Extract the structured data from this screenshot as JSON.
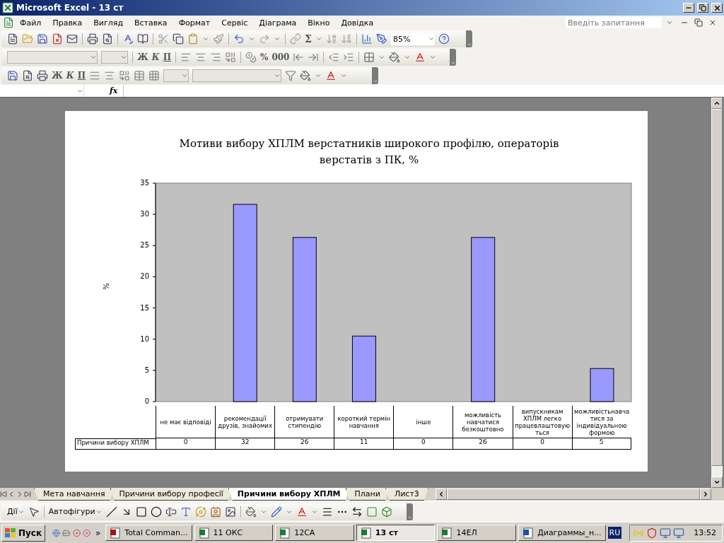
{
  "window": {
    "title": "Microsoft Excel - 13 ст"
  },
  "menu": {
    "items": [
      "Файл",
      "Правка",
      "Вигляд",
      "Вставка",
      "Формат",
      "Сервіс",
      "Діаграма",
      "Вікно",
      "Довідка"
    ],
    "help_field": {
      "placeholder": "Введіть запитання"
    }
  },
  "standard_toolbar": {
    "sum": "Σ",
    "zoom": "85%"
  },
  "format_toolbar": {
    "bold": "Ж",
    "italic": "К",
    "underline": "П",
    "percent": "%",
    "thousands": "000"
  },
  "chart_toolbar": {
    "bold": "Ж",
    "italic": "К",
    "underline": "П"
  },
  "formula_bar": {
    "fx": "fx"
  },
  "chart": {
    "chart_data": {
      "type": "bar",
      "title": "Мотиви вибору ХПЛМ верстатників широкого профілю, операторів верстатів з ПК, %",
      "ylabel": "%",
      "categories": [
        "не має відповіді",
        "рекомендації друзів, знайомих",
        "отримувати стипендію",
        "короткий термін навчання",
        "інше",
        "можливість навчатися безкоштовно",
        "випускникам ХПЛМ легко працевлаштовую ться",
        "можливістьнавча тися за індивідуальною формою"
      ],
      "series": [
        {
          "name": "Причини вибору ХПЛМ",
          "color": "#9999ff",
          "values": [
            0,
            31.6,
            26.3,
            10.5,
            0,
            26.3,
            0,
            5.3
          ]
        }
      ],
      "ylim": [
        0,
        35
      ],
      "yticks": [
        0,
        5,
        10,
        15,
        20,
        25,
        30,
        35
      ]
    },
    "data_table_values": [
      "0",
      "32",
      "26",
      "11",
      "0",
      "26",
      "0",
      "5"
    ]
  },
  "sheet_tabs": [
    {
      "label": "Мета навчання",
      "selected": false
    },
    {
      "label": "Причини вибору професії",
      "selected": false
    },
    {
      "label": "Причини вибору ХПЛМ",
      "selected": true
    },
    {
      "label": "Плани",
      "selected": false
    },
    {
      "label": "Лист3",
      "selected": false
    }
  ],
  "drawing_toolbar": {
    "actions": "Дії",
    "autoshapes": "Автофігури"
  },
  "taskbar": {
    "start": "Пуск",
    "quick_launch_more": "»",
    "tasks": [
      {
        "label": "Total Comman...",
        "kind": "app",
        "selected": false
      },
      {
        "label": "11 ОКС",
        "kind": "excel",
        "selected": false
      },
      {
        "label": "12СА",
        "kind": "excel",
        "selected": false
      },
      {
        "label": "13 ст",
        "kind": "excel",
        "selected": true
      },
      {
        "label": "14ЕЛ",
        "kind": "excel",
        "selected": false
      },
      {
        "label": "Диаграммы_н...",
        "kind": "word",
        "selected": false
      }
    ],
    "language": "RU",
    "clock": "13:52"
  }
}
